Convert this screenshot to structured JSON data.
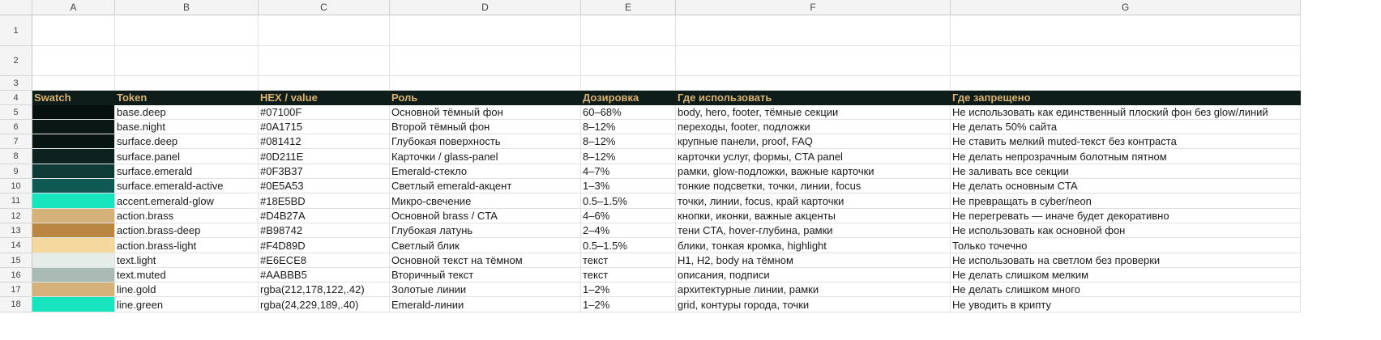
{
  "columns": [
    "A",
    "B",
    "C",
    "D",
    "E",
    "F",
    "G"
  ],
  "rows": [
    "1",
    "2",
    "3",
    "4",
    "5",
    "6",
    "7",
    "8",
    "9",
    "10",
    "11",
    "12",
    "13",
    "14",
    "15",
    "16",
    "17",
    "18"
  ],
  "header": {
    "swatch": "Swatch",
    "token": "Token",
    "hex": "HEX / value",
    "role": "Роль",
    "dosage": "Дозировка",
    "use": "Где использовать",
    "forbidden": "Где запрещено"
  },
  "tokens": [
    {
      "swatch": "#07100F",
      "token": "base.deep",
      "hex": "#07100F",
      "role": "Основной тёмный фон",
      "dosage": "60–68%",
      "use": "body, hero, footer, тёмные секции",
      "forbidden": "Не использовать как единственный плоский фон без glow/линий"
    },
    {
      "swatch": "#0A1715",
      "token": "base.night",
      "hex": "#0A1715",
      "role": "Второй тёмный фон",
      "dosage": "8–12%",
      "use": "переходы, footer, подложки",
      "forbidden": "Не делать 50% сайта"
    },
    {
      "swatch": "#081412",
      "token": "surface.deep",
      "hex": "#081412",
      "role": "Глубокая поверхность",
      "dosage": "8–12%",
      "use": "крупные панели, proof, FAQ",
      "forbidden": "Не ставить мелкий muted-текст без контраста"
    },
    {
      "swatch": "#0D211E",
      "token": "surface.panel",
      "hex": "#0D211E",
      "role": "Карточки / glass-panel",
      "dosage": "8–12%",
      "use": "карточки услуг, формы, CTA panel",
      "forbidden": "Не делать непрозрачным болотным пятном"
    },
    {
      "swatch": "#0F3B37",
      "token": "surface.emerald",
      "hex": "#0F3B37",
      "role": "Emerald-стекло",
      "dosage": "4–7%",
      "use": "рамки, glow-подложки, важные карточки",
      "forbidden": "Не заливать все секции"
    },
    {
      "swatch": "#0E5A53",
      "token": "surface.emerald-active",
      "hex": "#0E5A53",
      "role": "Светлый emerald-акцент",
      "dosage": "1–3%",
      "use": "тонкие подсветки, точки, линии, focus",
      "forbidden": "Не делать основным CTA"
    },
    {
      "swatch": "#18E5BD",
      "token": "accent.emerald-glow",
      "hex": "#18E5BD",
      "role": "Микро-свечение",
      "dosage": "0.5–1.5%",
      "use": "точки, линии, focus, край карточки",
      "forbidden": "Не превращать в cyber/neon"
    },
    {
      "swatch": "#D4B27A",
      "token": "action.brass",
      "hex": "#D4B27A",
      "role": "Основной brass / CTA",
      "dosage": "4–6%",
      "use": "кнопки, иконки, важные акценты",
      "forbidden": "Не перегревать — иначе будет декоративно"
    },
    {
      "swatch": "#B98742",
      "token": "action.brass-deep",
      "hex": "#B98742",
      "role": "Глубокая латунь",
      "dosage": "2–4%",
      "use": "тени CTA, hover-глубина, рамки",
      "forbidden": "Не использовать как основной фон"
    },
    {
      "swatch": "#F4D89D",
      "token": "action.brass-light",
      "hex": "#F4D89D",
      "role": "Светлый блик",
      "dosage": "0.5–1.5%",
      "use": "блики, тонкая кромка, highlight",
      "forbidden": "Только точечно"
    },
    {
      "swatch": "#E6ECE8",
      "token": "text.light",
      "hex": "#E6ECE8",
      "role": "Основной текст на тёмном",
      "dosage": "текст",
      "use": "H1, H2, body на тёмном",
      "forbidden": "Не использовать на светлом без проверки"
    },
    {
      "swatch": "#AABBB5",
      "token": "text.muted",
      "hex": "#AABBB5",
      "role": "Вторичный текст",
      "dosage": "текст",
      "use": "описания, подписи",
      "forbidden": "Не делать слишком мелким"
    },
    {
      "swatch": "#D4B27A",
      "token": "line.gold",
      "hex": "rgba(212,178,122,.42)",
      "role": "Золотые линии",
      "dosage": "1–2%",
      "use": "архитектурные линии, рамки",
      "forbidden": "Не делать слишком много"
    },
    {
      "swatch": "#18E5BD",
      "token": "line.green",
      "hex": "rgba(24,229,189,.40)",
      "role": "Emerald-линии",
      "dosage": "1–2%",
      "use": "grid, контуры города, точки",
      "forbidden": "Не уводить в крипту"
    }
  ]
}
